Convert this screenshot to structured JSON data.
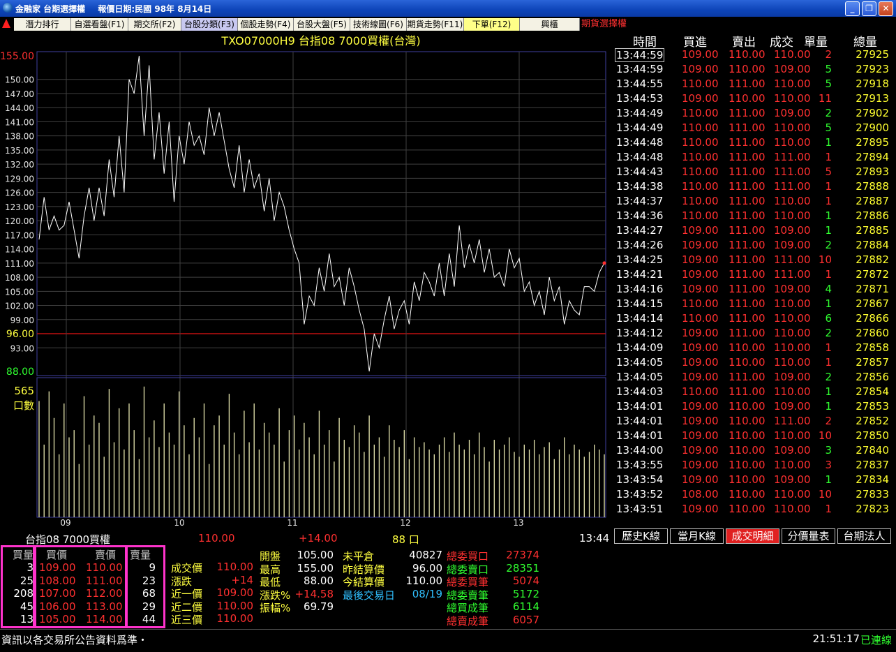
{
  "window": {
    "title": "金融家 台期選擇權",
    "report_date": "報價日期:民國 98年 8月14日"
  },
  "menu": {
    "tabs": [
      {
        "label": "潛力排行"
      },
      {
        "label": "自選看盤(F1)"
      },
      {
        "label": "期交所(F2)"
      },
      {
        "label": "台股分類(F3)"
      },
      {
        "label": "個股走勢(F4)"
      },
      {
        "label": "台股大盤(F5)"
      },
      {
        "label": "技術線圖(F6)"
      },
      {
        "label": "期貨走勢(F11)"
      },
      {
        "label": "下單(F12)"
      },
      {
        "label": "興櫃"
      }
    ],
    "right_label": "期貨選擇權"
  },
  "chart_data": {
    "type": "line",
    "title": "TXO07000H9  台指08  7000買權(台灣)",
    "price_axis": {
      "ylim": [
        88,
        155
      ],
      "tick_labels": [
        "155.00",
        "150.00",
        "147.00",
        "144.00",
        "141.00",
        "138.00",
        "135.00",
        "132.00",
        "129.00",
        "126.00",
        "123.00",
        "120.00",
        "117.00",
        "114.00",
        "111.00",
        "108.00",
        "105.00",
        "102.00",
        "99.00",
        "96.00",
        "93.00",
        "88.00"
      ],
      "reference_price": 96.0
    },
    "volume_axis": {
      "max_label": "565",
      "unit_label": "口數",
      "ylim": [
        0,
        565
      ]
    },
    "x_tick_labels": [
      "09",
      "10",
      "11",
      "12",
      "13"
    ],
    "price_series": [
      116,
      125,
      118,
      121,
      118,
      119,
      124,
      118,
      112,
      121,
      127,
      120,
      127,
      121,
      133,
      125,
      138,
      126,
      150,
      147,
      155,
      138,
      153,
      133,
      143,
      130,
      141,
      124,
      138,
      132,
      141,
      136,
      138,
      134,
      144,
      138,
      143,
      137,
      131,
      127,
      136,
      126,
      133,
      127,
      130,
      122,
      129,
      120,
      126,
      123,
      118,
      114,
      111,
      98,
      104,
      102,
      110,
      105,
      113,
      106,
      108,
      102,
      110,
      106,
      101,
      97,
      88,
      96,
      93,
      99,
      104,
      97,
      101,
      103,
      98,
      107,
      103,
      109,
      107,
      104,
      111,
      104,
      113,
      106,
      119,
      110,
      115,
      111,
      116,
      109,
      114,
      108,
      109,
      106,
      114,
      110,
      112,
      105,
      107,
      102,
      105,
      100,
      108,
      103,
      106,
      98,
      103,
      101,
      100,
      106,
      106,
      105,
      109,
      111
    ],
    "volume_series": [
      480,
      300,
      520,
      410,
      260,
      470,
      330,
      360,
      220,
      500,
      300,
      420,
      390,
      250,
      530,
      310,
      450,
      280,
      470,
      360,
      240,
      540,
      330,
      400,
      290,
      470,
      350,
      300,
      520,
      380,
      260,
      410,
      330,
      470,
      220,
      380,
      420,
      300,
      510,
      350,
      260,
      440,
      310,
      470,
      280,
      390,
      350,
      300,
      450,
      230,
      360,
      420,
      280,
      390,
      330,
      260,
      440,
      300,
      360,
      230,
      410,
      320,
      290,
      380,
      350,
      270,
      420,
      300,
      330,
      250,
      380,
      320,
      290,
      360,
      240,
      330,
      290,
      310,
      280,
      260,
      300,
      330,
      270,
      350,
      300,
      280,
      320,
      260,
      350,
      290,
      230,
      320,
      280,
      300,
      330,
      270,
      250,
      300,
      280,
      320,
      260,
      290,
      310,
      240,
      280,
      330,
      260,
      300,
      280,
      250,
      270,
      300,
      280,
      260
    ]
  },
  "chart_footer": {
    "name": "台指08  7000買權",
    "price": "110.00",
    "change": "+14.00",
    "volume": "88 口",
    "time": "13:44"
  },
  "ticks": {
    "headers": [
      "時間",
      "買進",
      "賣出",
      "成交",
      "單量",
      "總量"
    ],
    "rows": [
      [
        "13:44:59",
        "109.00",
        "110.00",
        "110.00",
        "2",
        "27925"
      ],
      [
        "13:44:59",
        "109.00",
        "110.00",
        "109.00",
        "5",
        "27923"
      ],
      [
        "13:44:55",
        "110.00",
        "111.00",
        "110.00",
        "5",
        "27918"
      ],
      [
        "13:44:53",
        "109.00",
        "110.00",
        "110.00",
        "11",
        "27913"
      ],
      [
        "13:44:49",
        "110.00",
        "111.00",
        "109.00",
        "2",
        "27902"
      ],
      [
        "13:44:49",
        "110.00",
        "111.00",
        "110.00",
        "5",
        "27900"
      ],
      [
        "13:44:48",
        "110.00",
        "111.00",
        "110.00",
        "1",
        "27895"
      ],
      [
        "13:44:48",
        "110.00",
        "111.00",
        "111.00",
        "1",
        "27894"
      ],
      [
        "13:44:43",
        "110.00",
        "111.00",
        "111.00",
        "5",
        "27893"
      ],
      [
        "13:44:38",
        "110.00",
        "111.00",
        "111.00",
        "1",
        "27888"
      ],
      [
        "13:44:37",
        "110.00",
        "111.00",
        "110.00",
        "1",
        "27887"
      ],
      [
        "13:44:36",
        "110.00",
        "111.00",
        "110.00",
        "1",
        "27886"
      ],
      [
        "13:44:27",
        "109.00",
        "111.00",
        "109.00",
        "1",
        "27885"
      ],
      [
        "13:44:26",
        "109.00",
        "111.00",
        "109.00",
        "2",
        "27884"
      ],
      [
        "13:44:25",
        "109.00",
        "111.00",
        "111.00",
        "10",
        "27882"
      ],
      [
        "13:44:21",
        "109.00",
        "111.00",
        "111.00",
        "1",
        "27872"
      ],
      [
        "13:44:16",
        "109.00",
        "111.00",
        "109.00",
        "4",
        "27871"
      ],
      [
        "13:44:15",
        "110.00",
        "111.00",
        "110.00",
        "1",
        "27867"
      ],
      [
        "13:44:14",
        "110.00",
        "111.00",
        "110.00",
        "6",
        "27866"
      ],
      [
        "13:44:12",
        "109.00",
        "111.00",
        "110.00",
        "2",
        "27860"
      ],
      [
        "13:44:09",
        "109.00",
        "110.00",
        "110.00",
        "1",
        "27858"
      ],
      [
        "13:44:05",
        "109.00",
        "110.00",
        "110.00",
        "1",
        "27857"
      ],
      [
        "13:44:05",
        "109.00",
        "111.00",
        "109.00",
        "2",
        "27856"
      ],
      [
        "13:44:03",
        "110.00",
        "111.00",
        "110.00",
        "1",
        "27854"
      ],
      [
        "13:44:01",
        "109.00",
        "110.00",
        "109.00",
        "1",
        "27853"
      ],
      [
        "13:44:01",
        "109.00",
        "110.00",
        "111.00",
        "2",
        "27852"
      ],
      [
        "13:44:01",
        "109.00",
        "110.00",
        "110.00",
        "10",
        "27850"
      ],
      [
        "13:44:00",
        "109.00",
        "110.00",
        "109.00",
        "3",
        "27840"
      ],
      [
        "13:43:55",
        "109.00",
        "110.00",
        "110.00",
        "3",
        "27837"
      ],
      [
        "13:43:54",
        "109.00",
        "110.00",
        "109.00",
        "1",
        "27834"
      ],
      [
        "13:43:52",
        "108.00",
        "110.00",
        "110.00",
        "10",
        "27833"
      ],
      [
        "13:43:51",
        "109.00",
        "110.00",
        "110.00",
        "1",
        "27823"
      ]
    ],
    "volume_colors": [
      "#ff3030",
      "#30ff30",
      "#30ff30",
      "#ff3030",
      "#30ff30",
      "#30ff30",
      "#30ff30",
      "#ff3030",
      "#ff3030",
      "#ff3030",
      "#ff3030",
      "#30ff30",
      "#30ff30",
      "#30ff30",
      "#ff3030",
      "#ff3030",
      "#30ff30",
      "#30ff30",
      "#30ff30",
      "#30ff30",
      "#ff3030",
      "#ff3030",
      "#30ff30",
      "#30ff30",
      "#30ff30",
      "#ff3030",
      "#ff3030",
      "#30ff30",
      "#ff3030",
      "#30ff30",
      "#ff3030",
      "#ff3030"
    ]
  },
  "bottom_tabs": [
    "歷史K線",
    "當月K線",
    "成交明細",
    "分價量表",
    "台期法人"
  ],
  "orderbook": {
    "headers": [
      "買量",
      "買價",
      "賣價",
      "賣量"
    ],
    "rows": [
      [
        "3",
        "109.00",
        "110.00",
        "9"
      ],
      [
        "25",
        "108.00",
        "111.00",
        "23"
      ],
      [
        "208",
        "107.00",
        "112.00",
        "68"
      ],
      [
        "45",
        "106.00",
        "113.00",
        "29"
      ],
      [
        "13",
        "105.00",
        "114.00",
        "44"
      ]
    ]
  },
  "quote": {
    "left": [
      {
        "label": "成交價",
        "value": "110.00"
      },
      {
        "label": "漲跌",
        "value": "+14"
      },
      {
        "label": "近一價",
        "value": "109.00"
      },
      {
        "label": "近二價",
        "value": "110.00"
      },
      {
        "label": "近三價",
        "value": "110.00"
      }
    ],
    "mid": [
      {
        "label": "開盤",
        "value": "105.00"
      },
      {
        "label": "最高",
        "value": "155.00"
      },
      {
        "label": "最低",
        "value": "88.00"
      },
      {
        "label": "漲跌%",
        "value": "+14.58"
      },
      {
        "label": "振幅%",
        "value": "69.79"
      }
    ],
    "right": [
      {
        "label": "未平倉",
        "value": "40827"
      },
      {
        "label": "昨結算價",
        "value": "96.00"
      },
      {
        "label": "今結算價",
        "value": "110.00"
      },
      {
        "label": "最後交易日",
        "value": "08/19"
      }
    ],
    "totals": [
      {
        "label": "總委買口",
        "value": "27374"
      },
      {
        "label": "總委賣口",
        "value": "28351"
      },
      {
        "label": "總委買筆",
        "value": "5074"
      },
      {
        "label": "總委賣筆",
        "value": "5172"
      },
      {
        "label": "總買成筆",
        "value": "6114"
      },
      {
        "label": "總賣成筆",
        "value": "6057"
      }
    ]
  },
  "status": {
    "notice": "資訊以各交易所公告資料爲準・",
    "time": "21:51:17",
    "connection": "已連線"
  }
}
